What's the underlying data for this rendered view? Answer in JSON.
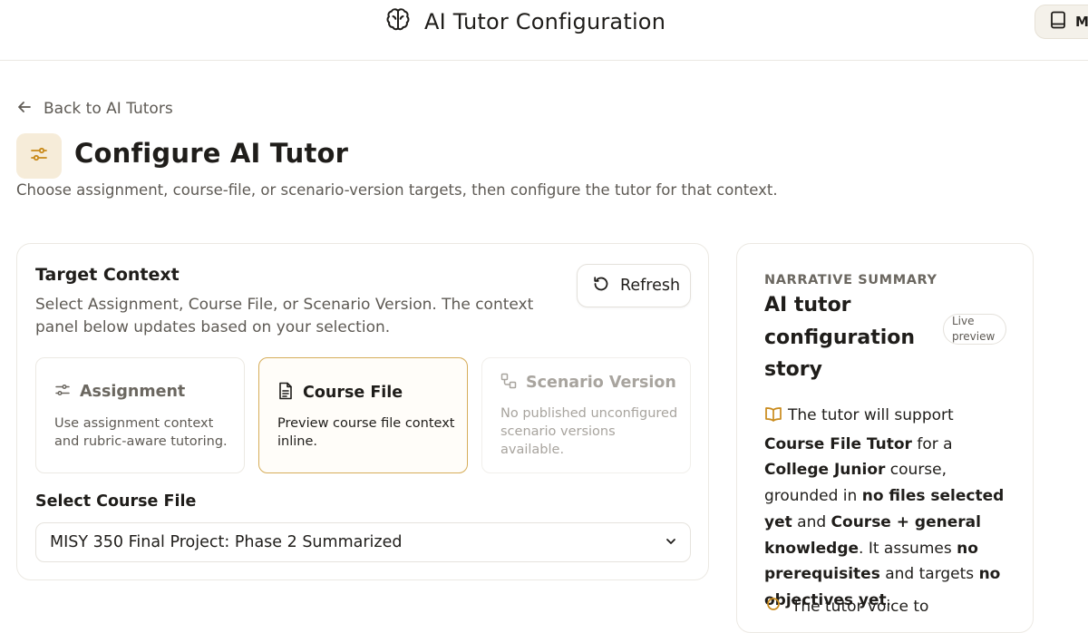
{
  "header": {
    "title": "AI Tutor Configuration",
    "right_button_label": "M",
    "brain_icon": "brain-icon",
    "book_icon": "book-icon"
  },
  "nav": {
    "back_label": "Back to AI Tutors",
    "back_icon": "arrow-left-icon"
  },
  "page": {
    "icon": "sliders-icon",
    "title": "Configure AI Tutor",
    "subtitle": "Choose assignment, course-file, or scenario-version targets, then configure the tutor for that context."
  },
  "target_context": {
    "title": "Target Context",
    "description": "Select Assignment, Course File, or Scenario Version. The context panel below updates based on your selection.",
    "refresh_label": "Refresh",
    "options": [
      {
        "label": "Assignment",
        "description": "Use assignment context and rubric-aware tutoring.",
        "icon": "sliders-icon",
        "state": "default"
      },
      {
        "label": "Course File",
        "description": "Preview course file context inline.",
        "icon": "file-text-icon",
        "state": "selected"
      },
      {
        "label": "Scenario Version",
        "description": "No published unconfigured scenario versions available.",
        "icon": "workflow-icon",
        "state": "disabled"
      }
    ],
    "select_label": "Select Course File",
    "select_value": "MISY 350 Final Project: Phase 2 Summarized"
  },
  "summary": {
    "eyebrow": "NARRATIVE SUMMARY",
    "title": "AI tutor configuration story",
    "badge_line1": "Live",
    "badge_line2": "preview",
    "p1": "The tutor will support",
    "p2": "Course File Tutor",
    "p3": "for a",
    "p4": "College Junior",
    "p5": "course, grounded in",
    "p6": "no files selected yet",
    "p7": "and",
    "p8": "Course + general knowledge",
    "p9": ". It assumes",
    "p10": "no prerequisites",
    "p11": "and targets",
    "p12": "no objectives yet",
    "p13": ".",
    "next_line": "The tutor voice to"
  },
  "colors": {
    "accent": "#c98a1b",
    "accent_bg": "#f6ecd9",
    "selected_border": "#d6ad5a"
  }
}
